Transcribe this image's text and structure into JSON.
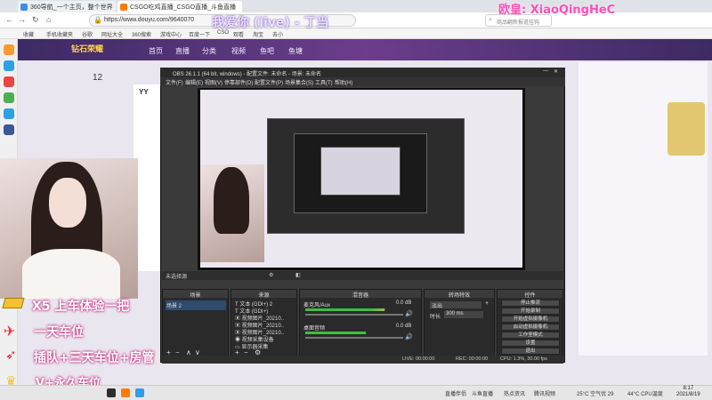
{
  "browser": {
    "tabs": [
      {
        "label": "360导航_一个主页，整个世界",
        "color": "#3d8ee8"
      },
      {
        "label": "CSGO吃鸡直播_CSGO直播_斗鱼直播",
        "color": "#ff7a00"
      }
    ],
    "url": "https://www.douyu.com/9640070",
    "search_placeholder": "商品翻新报道挂钩",
    "bookmarks": [
      "收藏",
      "手机收藏夹",
      "谷歌",
      "网址大全",
      "360搜索",
      "游戏中心",
      "百度一下",
      "CSO",
      "观看",
      "淘宝",
      "去小"
    ]
  },
  "overlay": {
    "top_right": "欧皇: XiaoQingHeC",
    "window_title": "我爱你 (live) - 丁当",
    "promo": [
      {
        "text": "X5 上车体验一把",
        "icon": "gold-bar-icon"
      },
      {
        "text": "一天车位",
        "icon": "airplane-icon"
      },
      {
        "text": "插队+三天车位+房管",
        "icon": "rocket-icon"
      },
      {
        "text": "V+永久车位",
        "icon": "crown-icon"
      }
    ]
  },
  "site": {
    "nav": [
      "首页",
      "直播",
      "分类",
      "视频",
      "鱼吧",
      "鱼塘"
    ],
    "logo": "钻石荣耀",
    "room_count": "12"
  },
  "obs": {
    "title": "OBS 26.1.1 (64 bit, windows) - 配置文件: 未命名 - 场景: 未命名",
    "menu": [
      "文件(F)",
      "编辑(E)",
      "视图(V)",
      "停靠部件(D)",
      "配置文件(P)",
      "场景集合(S)",
      "工具(T)",
      "帮助(H)"
    ],
    "no_source": "未选择源",
    "scenes_header": "场景",
    "scenes": [
      "场景 2"
    ],
    "sources_header": "来源",
    "sources": [
      "文本 (GDI+) 2",
      "文本 (GDI+)",
      "视频图片_20210..",
      "视频图片_20210..",
      "视频图片_20210..",
      "视频采集设备",
      "显示器采集"
    ],
    "mixer_header": "混音器",
    "mixer": [
      {
        "name": "麦克风/Aux",
        "db": "0.0 dB",
        "level": 0.72
      },
      {
        "name": "桌面音频",
        "db": "0.0 dB",
        "level": 0.55
      }
    ],
    "transitions_header": "转场特效",
    "transition": "淡出",
    "duration_label": "时长",
    "duration": "300 ms",
    "controls_header": "控件",
    "controls": [
      "停止推流",
      "开始录制",
      "开始虚拟摄像机",
      "启动虚拟摄像机",
      "工作室模式",
      "设置",
      "退出"
    ],
    "status": {
      "live": "LIVE: 00:00:00",
      "rec": "REC: 00:00:00",
      "cpu": "CPU: 1.3%, 30.00 fps"
    }
  },
  "taskbar": {
    "items": [
      "直播伴侣",
      "斗鱼直播",
      "热点资讯",
      "腾讯视频"
    ],
    "weather": "25°C 空气优 29",
    "cpu": "44°C CPU温度",
    "time": "8:17",
    "date": "2021/8/19"
  }
}
